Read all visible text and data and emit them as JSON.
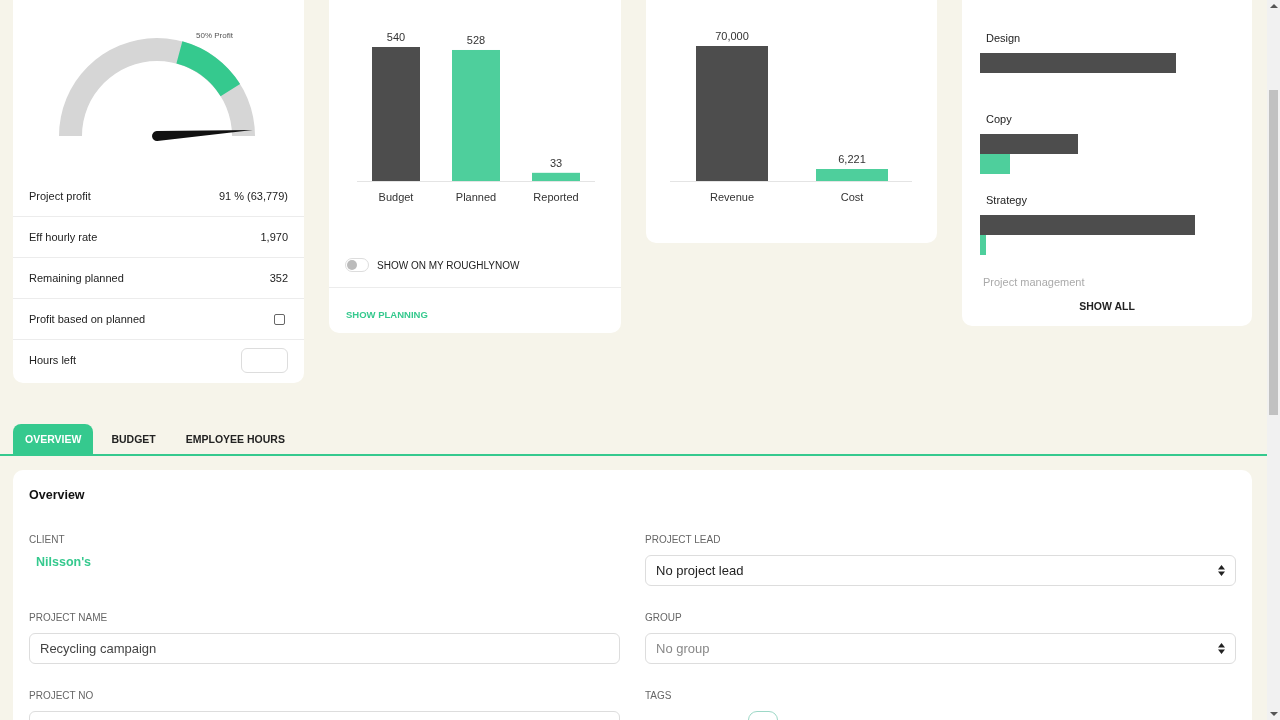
{
  "profit_card": {
    "gauge": {
      "label": "50% Profit"
    },
    "rows": [
      {
        "kind": "value",
        "label": "Project profit",
        "value": "91 % (63,779)"
      },
      {
        "kind": "value",
        "label": "Eff hourly rate",
        "value": "1,970"
      },
      {
        "kind": "value",
        "label": "Remaining planned",
        "value": "352"
      },
      {
        "kind": "checkbox",
        "label": "Profit based on planned",
        "checked": false
      },
      {
        "kind": "input",
        "label": "Hours left"
      }
    ]
  },
  "hours_card": {
    "chart_data": {
      "type": "bar",
      "categories": [
        "Budget",
        "Planned",
        "Reported"
      ],
      "series": [
        {
          "color": "#4d4d4d",
          "values": [
            540,
            null,
            null
          ]
        },
        {
          "color": "#4ecf9c",
          "values": [
            null,
            528,
            33
          ]
        }
      ],
      "stacked": true,
      "data_labels": true,
      "value_labels": [
        "540",
        "528",
        "33"
      ]
    },
    "toggle": {
      "label": "SHOW ON MY ROUGHLYNOW",
      "on": false
    },
    "link": "SHOW PLANNING"
  },
  "money_card": {
    "chart_data": {
      "type": "bar",
      "categories": [
        "Revenue",
        "Cost"
      ],
      "series": [
        {
          "color": "#4d4d4d",
          "values": [
            70000,
            null
          ],
          "value_labels": [
            "70,000",
            null
          ]
        },
        {
          "color": "#4ecf9c",
          "values": [
            null,
            6221
          ],
          "value_labels": [
            null,
            "6,221"
          ]
        }
      ],
      "stacked": true
    }
  },
  "activities_card": {
    "labels": [
      "Design",
      "Copy",
      "Strategy"
    ],
    "faded_label": "Project management",
    "button": "SHOW ALL"
  },
  "tabs": [
    {
      "label": "OVERVIEW",
      "selected": true
    },
    {
      "label": "BUDGET",
      "selected": false
    },
    {
      "label": "EMPLOYEE HOURS",
      "selected": false
    }
  ],
  "overview": {
    "title": "Overview",
    "left": [
      {
        "kind": "link",
        "label": "CLIENT",
        "value": "Nilsson's"
      },
      {
        "kind": "input",
        "label": "PROJECT NAME",
        "value": "Recycling campaign"
      },
      {
        "kind": "input",
        "label": "PROJECT NO"
      }
    ],
    "right": [
      {
        "kind": "select",
        "label": "PROJECT LEAD",
        "value": "No project lead"
      },
      {
        "kind": "select",
        "label": "GROUP",
        "placeholder": "No group"
      },
      {
        "kind": "tags",
        "label": "TAGS"
      }
    ]
  }
}
